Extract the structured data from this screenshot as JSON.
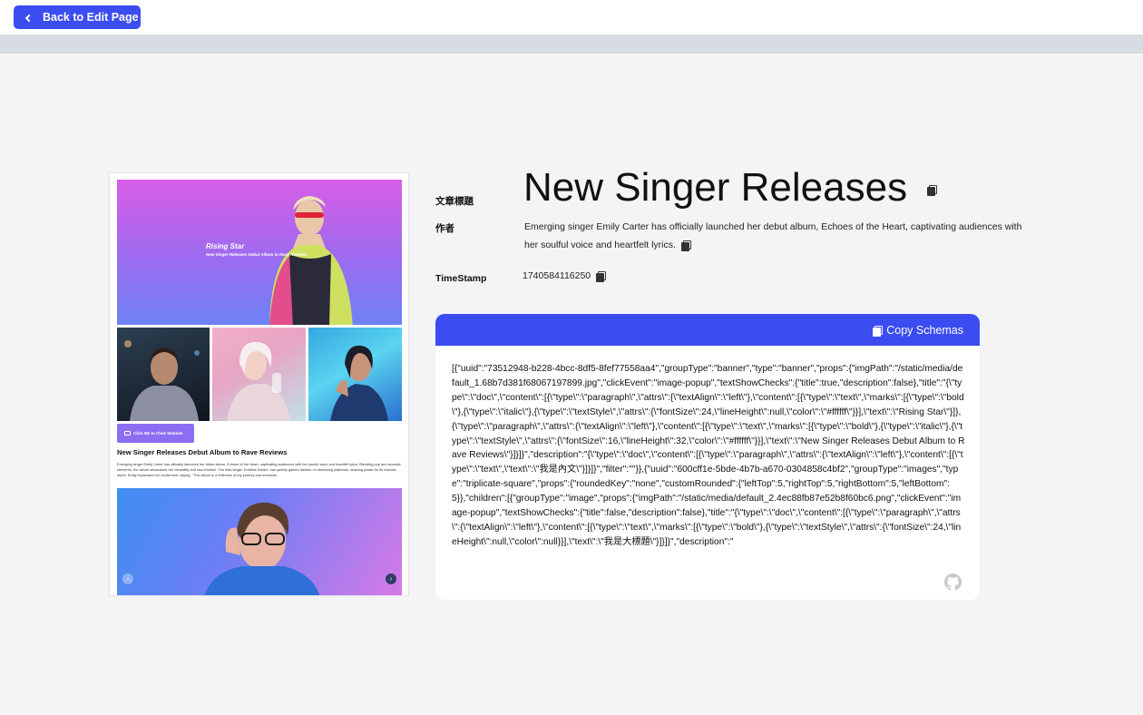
{
  "nav": {
    "back_label": "Back to Edit Page"
  },
  "preview": {
    "hero_title": "Rising Star",
    "hero_subtitle": "New Singer Releases Debut Album to Rave Reviews",
    "cta_label": "Click Me to Chek Website",
    "article_title": "New Singer Releases Debut Album to Rave Reviews",
    "article_body": "Emerging singer Emily Carter has officially launched her debut album, Echoes of the Heart, captivating audiences with her soulful voice and heartfelt lyrics. Blending pop and acoustic elements, the album showcases her versatility and raw emotion. The lead single, Endless Dream, has quickly gained traction on streaming platforms, drawing praise for its melodic depth. Emily expressed her excitement, saying, \"This album is a reflection of my journey and emotions."
  },
  "info": {
    "title_label": "文章標題",
    "title": "New Singer Releases",
    "author_label": "作者",
    "description": "Emerging singer Emily Carter has officially launched her debut album, Echoes of the Heart, captivating audiences with her soulful voice and heartfelt lyrics.",
    "timestamp_label": "TimeStamp",
    "timestamp": "1740584116250"
  },
  "schema": {
    "copy_label": "Copy Schemas",
    "json_text": "[{\"uuid\":\"73512948-b228-4bcc-8df5-8fef77558aa4\",\"groupType\":\"banner\",\"type\":\"banner\",\"props\":{\"imgPath\":\"/static/media/default_1.68b7d381f68067197899.jpg\",\"clickEvent\":\"image-popup\",\"textShowChecks\":{\"title\":true,\"description\":false},\"title\":\"{\\\"type\\\":\\\"doc\\\",\\\"content\\\":[{\\\"type\\\":\\\"paragraph\\\",\\\"attrs\\\":{\\\"textAlign\\\":\\\"left\\\"},\\\"content\\\":[{\\\"type\\\":\\\"text\\\",\\\"marks\\\":[{\\\"type\\\":\\\"bold\\\"},{\\\"type\\\":\\\"italic\\\"},{\\\"type\\\":\\\"textStyle\\\",\\\"attrs\\\":{\\\"fontSize\\\":24,\\\"lineHeight\\\":null,\\\"color\\\":\\\"#ffffff\\\"}}],\\\"text\\\":\\\"Rising Star\\\"}]},{\\\"type\\\":\\\"paragraph\\\",\\\"attrs\\\":{\\\"textAlign\\\":\\\"left\\\"},\\\"content\\\":[{\\\"type\\\":\\\"text\\\",\\\"marks\\\":[{\\\"type\\\":\\\"bold\\\"},{\\\"type\\\":\\\"italic\\\"},{\\\"type\\\":\\\"textStyle\\\",\\\"attrs\\\":{\\\"fontSize\\\":16,\\\"lineHeight\\\":32,\\\"color\\\":\\\"#ffffff\\\"}}],\\\"text\\\":\\\"New Singer Releases Debut Album to Rave Reviews\\\"}]}]}\",\"description\":\"{\\\"type\\\":\\\"doc\\\",\\\"content\\\":[{\\\"type\\\":\\\"paragraph\\\",\\\"attrs\\\":{\\\"textAlign\\\":\\\"left\\\"},\\\"content\\\":[{\\\"type\\\":\\\"text\\\",\\\"text\\\":\\\"我是內文\\\"}]}]}\",\"filter\":\"\"}},{\"uuid\":\"600cff1e-5bde-4b7b-a670-0304858c4bf2\",\"groupType\":\"images\",\"type\":\"triplicate-square\",\"props\":{\"roundedKey\":\"none\",\"customRounded\":{\"leftTop\":5,\"rightTop\":5,\"rightBottom\":5,\"leftBottom\":5}},\"children\":[{\"groupType\":\"image\",\"props\":{\"imgPath\":\"/static/media/default_2.4ec88fb87e52b8f60bc6.png\",\"clickEvent\":\"image-popup\",\"textShowChecks\":{\"title\":false,\"description\":false},\"title\":\"{\\\"type\\\":\\\"doc\\\",\\\"content\\\":[{\\\"type\\\":\\\"paragraph\\\",\\\"attrs\\\":{\\\"textAlign\\\":\\\"left\\\"},\\\"content\\\":[{\\\"type\\\":\\\"text\\\",\\\"marks\\\":[{\\\"type\\\":\\\"bold\\\"},{\\\"type\\\":\\\"textStyle\\\",\\\"attrs\\\":{\\\"fontSize\\\":24,\\\"lineHeight\\\":null,\\\"color\\\":null}}],\\\"text\\\":\\\"我是大標題\\\"}]}]}\",\"description\":\""
  },
  "colors": {
    "accent": "#3b4cf0",
    "cta": "#8b6ef2",
    "page_bg": "#f4f4f6",
    "header_strip": "#d7dbe2"
  },
  "icons": [
    "chevron-left-icon",
    "copy-icon",
    "github-icon",
    "chevron-right-icon",
    "website-icon"
  ]
}
